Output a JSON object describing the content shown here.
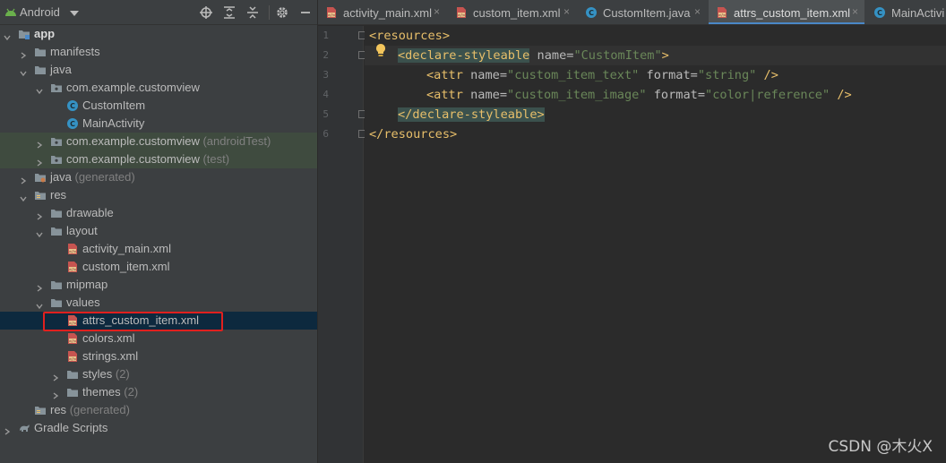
{
  "project_panel": {
    "view_label": "Android",
    "tree": [
      {
        "label": "app",
        "suffix": "",
        "icon": "module-folder-icon",
        "expanded": true
      },
      {
        "label": "manifests",
        "suffix": "",
        "icon": "folder-icon",
        "expanded": false
      },
      {
        "label": "java",
        "suffix": "",
        "icon": "folder-icon",
        "expanded": true
      },
      {
        "label": "com.example.customview",
        "suffix": "",
        "icon": "package-icon",
        "expanded": true
      },
      {
        "label": "CustomItem",
        "suffix": "",
        "icon": "class-icon"
      },
      {
        "label": "MainActivity",
        "suffix": "",
        "icon": "class-icon"
      },
      {
        "label": "com.example.customview",
        "suffix": "(androidTest)",
        "icon": "package-icon",
        "expanded": false
      },
      {
        "label": "com.example.customview",
        "suffix": "(test)",
        "icon": "package-icon",
        "expanded": false
      },
      {
        "label": "java",
        "suffix": "(generated)",
        "icon": "generated-folder-icon",
        "expanded": false
      },
      {
        "label": "res",
        "suffix": "",
        "icon": "res-folder-icon",
        "expanded": true
      },
      {
        "label": "drawable",
        "suffix": "",
        "icon": "folder-icon",
        "expanded": false
      },
      {
        "label": "layout",
        "suffix": "",
        "icon": "folder-icon",
        "expanded": true
      },
      {
        "label": "activity_main.xml",
        "suffix": "",
        "icon": "xml-file-icon"
      },
      {
        "label": "custom_item.xml",
        "suffix": "",
        "icon": "xml-file-icon"
      },
      {
        "label": "mipmap",
        "suffix": "",
        "icon": "folder-icon",
        "expanded": false
      },
      {
        "label": "values",
        "suffix": "",
        "icon": "folder-icon",
        "expanded": true
      },
      {
        "label": "attrs_custom_item.xml",
        "suffix": "",
        "icon": "xml-file-icon"
      },
      {
        "label": "colors.xml",
        "suffix": "",
        "icon": "xml-file-icon"
      },
      {
        "label": "strings.xml",
        "suffix": "",
        "icon": "xml-file-icon"
      },
      {
        "label": "styles",
        "suffix": "(2)",
        "icon": "folder-icon",
        "expanded": false
      },
      {
        "label": "themes",
        "suffix": "(2)",
        "icon": "folder-icon",
        "expanded": false
      },
      {
        "label": "res",
        "suffix": "(generated)",
        "icon": "res-folder-icon"
      },
      {
        "label": "Gradle Scripts",
        "suffix": "",
        "icon": "gradle-icon",
        "expanded": false
      }
    ]
  },
  "tabs": [
    {
      "label": "activity_main.xml",
      "icon": "xml-file-icon"
    },
    {
      "label": "custom_item.xml",
      "icon": "xml-file-icon"
    },
    {
      "label": "CustomItem.java",
      "icon": "class-icon"
    },
    {
      "label": "attrs_custom_item.xml",
      "icon": "xml-file-icon",
      "active": true
    },
    {
      "label": "MainActivi",
      "icon": "class-icon"
    }
  ],
  "editor": {
    "line_numbers": [
      "1",
      "2",
      "3",
      "4",
      "5",
      "6"
    ],
    "lines": {
      "l1": {
        "open": "<resources>"
      },
      "l2": {
        "tag": "<declare-styleable",
        "attr": " name=",
        "value": "\"CustomItem\"",
        "close": ">"
      },
      "l3": {
        "tag": "<attr",
        "attr1": " name=",
        "value1": "\"custom_item_text\"",
        "attr2": " format=",
        "value2": "\"string\"",
        "close": " />"
      },
      "l4": {
        "tag": "<attr",
        "attr1": " name=",
        "value1": "\"custom_item_image\"",
        "attr2": " format=",
        "value2": "\"color|reference\"",
        "close": " />"
      },
      "l5": {
        "close": "</declare-styleable>"
      },
      "l6": {
        "close": "</resources>"
      }
    }
  },
  "watermark": "CSDN @木火X",
  "colors": {
    "accent": "#4a88c7",
    "highlight_box": "#e0201e",
    "selection": "#0d293e"
  }
}
